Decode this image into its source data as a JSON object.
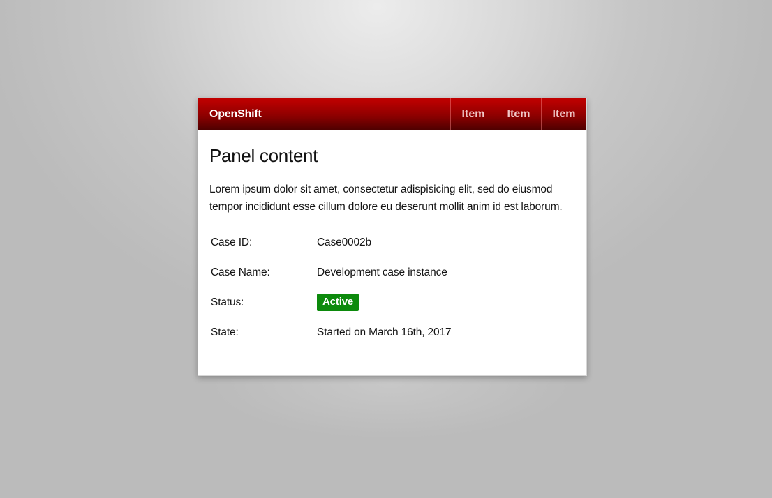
{
  "navbar": {
    "brand": "OpenShift",
    "items": [
      {
        "label": "Item"
      },
      {
        "label": "Item"
      },
      {
        "label": "Item"
      }
    ]
  },
  "panel": {
    "title": "Panel content",
    "description": "Lorem ipsum dolor sit amet, consectetur adispisicing elit, sed do eiusmod tempor incididunt esse cillum dolore eu deserunt mollit anim id est laborum.",
    "details": [
      {
        "label": "Case ID:",
        "value": "Case0002b"
      },
      {
        "label": "Case Name:",
        "value": "Development case instance"
      },
      {
        "label": "Status:",
        "value": "Active"
      },
      {
        "label": "State:",
        "value": "Started on March 16th, 2017"
      }
    ]
  },
  "colors": {
    "navbar_top": "#c10000",
    "navbar_bottom": "#4f0000",
    "status_active": "#0c8a0c",
    "panel_background": "#ffffff"
  }
}
